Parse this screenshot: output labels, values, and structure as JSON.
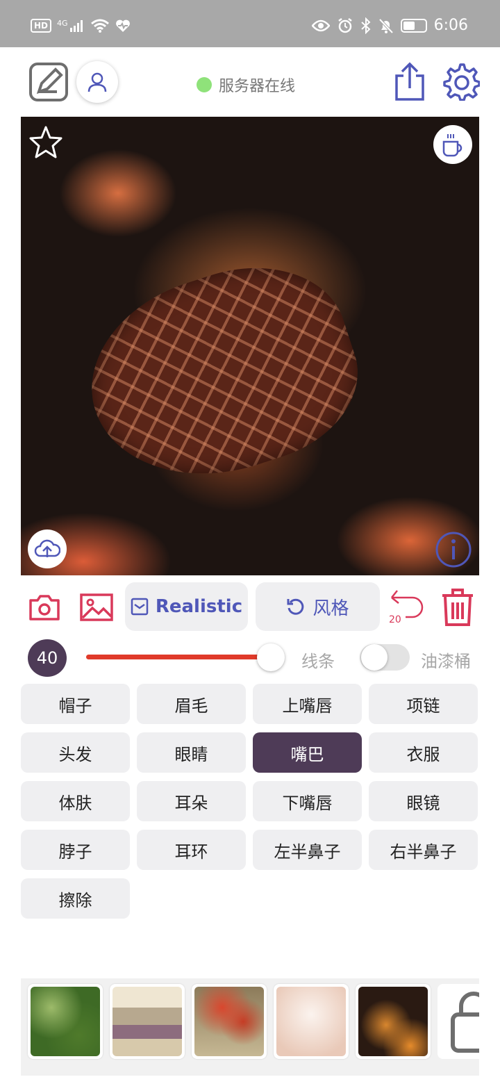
{
  "status_bar": {
    "hd": "HD",
    "network": "4G",
    "time": "6:06",
    "battery_level": 0.55
  },
  "header": {
    "server_status": "服务器在线",
    "server_color": "#8fe27a",
    "icons": [
      "edit-pencil-icon",
      "user-icon",
      "share-icon",
      "gear-icon"
    ]
  },
  "canvas": {
    "icons": [
      "star-icon",
      "coffee-cup-icon",
      "cloud-upload-icon",
      "info-icon"
    ]
  },
  "toolbar": {
    "mode_label": "Realistic",
    "style_label": "风格",
    "undo_count": "20",
    "icons": [
      "camera-icon",
      "image-icon",
      "mail-check-icon",
      "rotate-icon",
      "undo-icon",
      "trash-icon"
    ]
  },
  "brush": {
    "size": "40",
    "slider_fraction": 0.95,
    "line_label": "线条",
    "bucket_label": "油漆桶",
    "bucket_enabled": false
  },
  "labels": [
    {
      "text": "帽子",
      "active": false
    },
    {
      "text": "眉毛",
      "active": false
    },
    {
      "text": "上嘴唇",
      "active": false
    },
    {
      "text": "项链",
      "active": false
    },
    {
      "text": "头发",
      "active": false
    },
    {
      "text": "眼睛",
      "active": false
    },
    {
      "text": "嘴巴",
      "active": true
    },
    {
      "text": "衣服",
      "active": false
    },
    {
      "text": "体肤",
      "active": false
    },
    {
      "text": "耳朵",
      "active": false
    },
    {
      "text": "下嘴唇",
      "active": false
    },
    {
      "text": "眼镜",
      "active": false
    },
    {
      "text": "脖子",
      "active": false
    },
    {
      "text": "耳环",
      "active": false
    },
    {
      "text": "左半鼻子",
      "active": false
    },
    {
      "text": "右半鼻子",
      "active": false
    },
    {
      "text": "擦除",
      "active": false
    }
  ],
  "colors": {
    "accent": "#4f57b8",
    "danger": "#d9395a",
    "active_chip": "#4e3b57",
    "slider": "#e03a2a"
  },
  "thumbnails": [
    "green-foliage",
    "stone-moss",
    "red-flowers",
    "pale-blush",
    "dark-orange",
    "lock-icon"
  ]
}
